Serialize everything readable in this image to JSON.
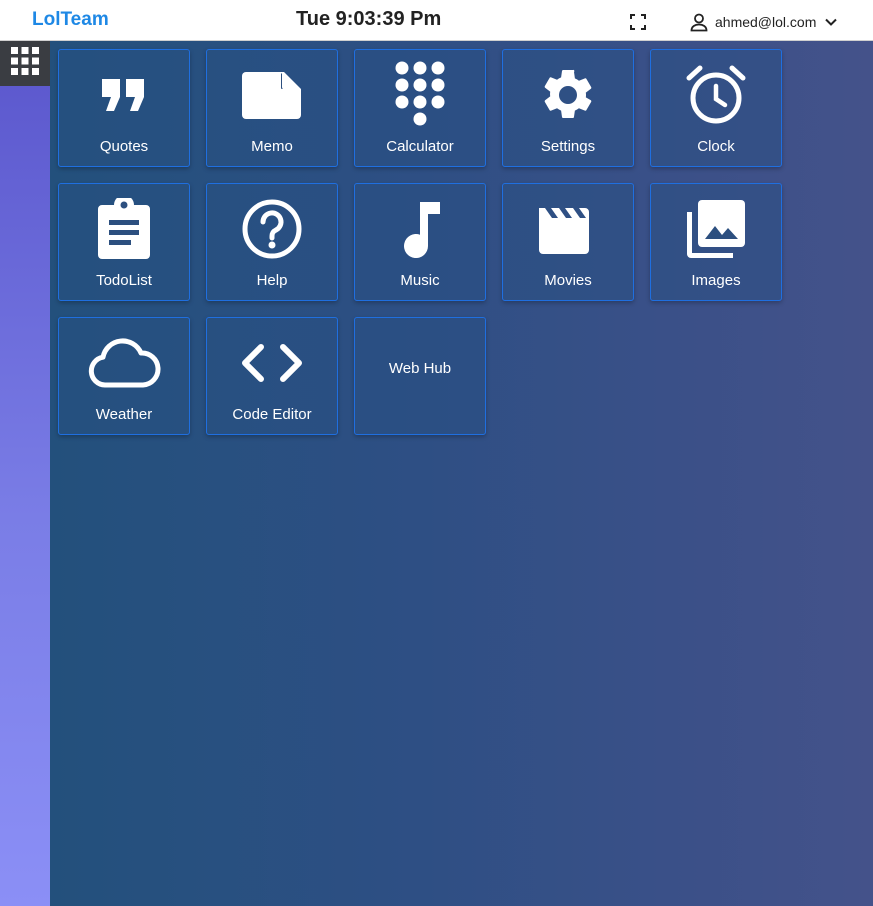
{
  "header": {
    "brand": "LolTeam",
    "datetime": "Tue 9:03:39 Pm",
    "user_email": "ahmed@lol.com"
  },
  "desktop": {
    "apps": [
      {
        "label": "Quotes",
        "icon": "quote-icon"
      },
      {
        "label": "Memo",
        "icon": "note-icon"
      },
      {
        "label": "Calculator",
        "icon": "dialpad-icon"
      },
      {
        "label": "Settings",
        "icon": "gear-icon"
      },
      {
        "label": "Clock",
        "icon": "alarm-clock-icon"
      },
      {
        "label": "TodoList",
        "icon": "clipboard-icon"
      },
      {
        "label": "Help",
        "icon": "help-circle-icon"
      },
      {
        "label": "Music",
        "icon": "music-note-icon"
      },
      {
        "label": "Movies",
        "icon": "clapperboard-icon"
      },
      {
        "label": "Images",
        "icon": "image-library-icon"
      },
      {
        "label": "Weather",
        "icon": "cloud-icon"
      },
      {
        "label": "Code Editor",
        "icon": "code-icon"
      },
      {
        "label": "Web Hub",
        "icon": ""
      }
    ]
  },
  "colors": {
    "brand": "#1e88e5",
    "tile_border": "#1f6fe0",
    "sidebar_top": "#5a56cc",
    "sidebar_bottom": "#8b8ff6"
  }
}
